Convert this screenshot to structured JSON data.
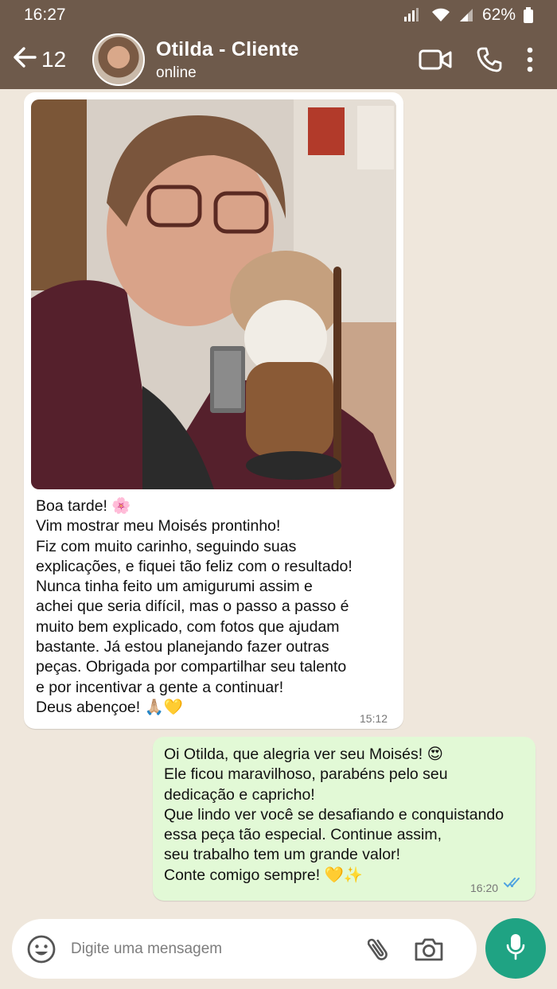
{
  "status_bar": {
    "time": "16:27",
    "battery": "62%"
  },
  "header": {
    "back_count": "12",
    "contact_name": "Otilda - Cliente",
    "contact_status": "online",
    "icons": [
      "back-arrow-icon",
      "video-call-icon",
      "phone-icon",
      "more-options-icon"
    ]
  },
  "messages": [
    {
      "direction": "incoming",
      "has_photo": true,
      "text": "Boa tarde! 🌸\nVim mostrar meu Moisés prontinho!\nFiz com muito carinho, seguindo suas\nexplicações, e fiquei tão feliz com o resultado!\nNunca tinha feito um amigurumi assim e\nachei que seria difícil, mas o passo a passo é\nmuito bem explicado, com fotos que ajudam\nbastante. Já estou planejando fazer outras\npeças. Obrigada por compartilhar seu talento\ne por incentivar a gente a continuar!\nDeus abençoe! 🙏🏼💛",
      "time": "15:12"
    },
    {
      "direction": "outgoing",
      "text": "Oi Otilda, que alegria ver seu Moisés! 😍\nEle ficou maravilhoso, parabéns pelo seu\ndedicação e capricho!\nQue lindo ver você se desafiando e conquistando\nessa peça tão especial. Continue assim,\nseu trabalho tem um grande valor!\nConte comigo sempre! 💛✨",
      "time": "16:20",
      "read": true
    }
  ],
  "composer": {
    "placeholder": "Digite uma mensagem",
    "icons": [
      "emoji-icon",
      "attach-icon",
      "camera-icon",
      "microphone-icon"
    ]
  },
  "colors": {
    "header": "#6e5a4b",
    "chat_background": "#efe7dc",
    "outgoing_bubble": "#e2f9d6",
    "mic_button": "#1fa383",
    "read_ticks": "#4fa3e0"
  }
}
